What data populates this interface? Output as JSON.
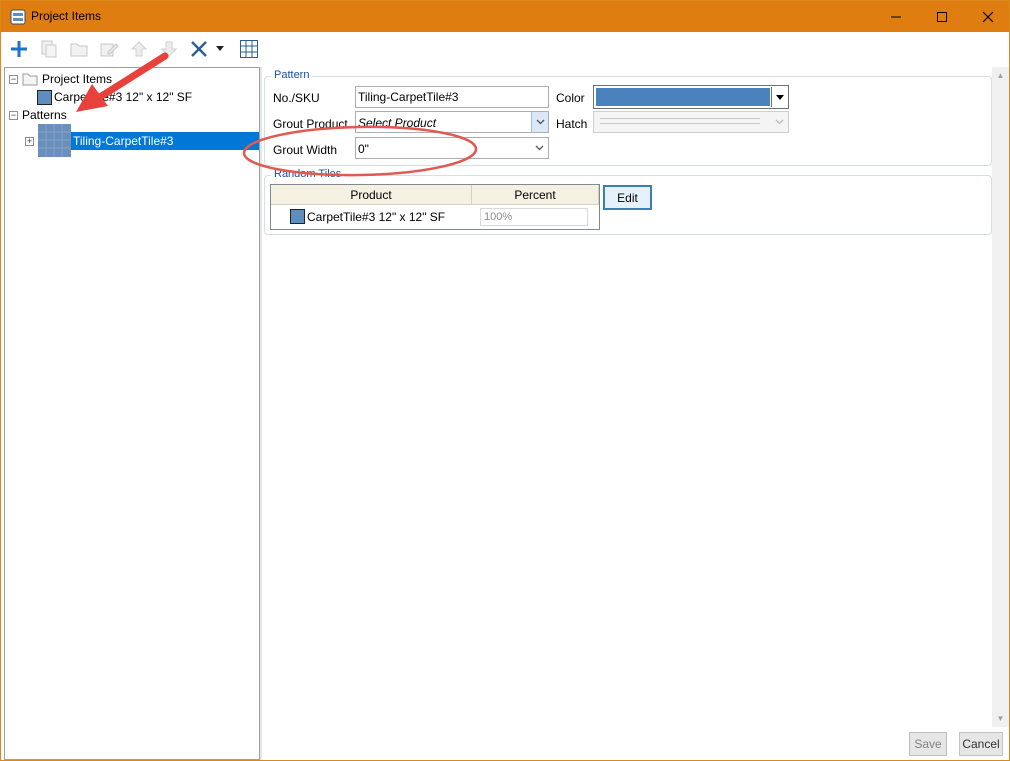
{
  "window": {
    "title": "Project Items",
    "accent_color": "#e07d10",
    "controls": [
      "minimize-icon",
      "maximize-icon",
      "close-icon"
    ]
  },
  "toolbar": {
    "buttons": [
      "add-icon",
      "copy-icon",
      "folder-icon",
      "edit-icon",
      "move-up-icon",
      "move-down-icon",
      "delete-icon",
      "dropdown-icon",
      "grid-icon"
    ]
  },
  "tree": {
    "project_items_label": "Project Items",
    "product_item_label": "CarpetTile#3 12\" x 12\" SF",
    "patterns_label": "Patterns",
    "pattern_item_label": "Tiling-CarpetTile#3",
    "swatch_color": "#5d8ebf"
  },
  "pattern": {
    "group_label": "Pattern",
    "sku_label": "No./SKU",
    "sku_value": "Tiling-CarpetTile#3",
    "color_label": "Color",
    "color_value": "#4a82bd",
    "grout_product_label": "Grout Product",
    "grout_product_placeholder": "Select Product",
    "hatch_label": "Hatch",
    "grout_width_label": "Grout Width",
    "grout_width_value": "0\""
  },
  "random_tiles": {
    "group_label": "Random Tiles",
    "columns": [
      "Product",
      "Percent"
    ],
    "rows": [
      {
        "product": "CarpetTile#3 12\" x 12\" SF",
        "percent": "100%"
      }
    ],
    "edit_label": "Edit"
  },
  "footer": {
    "save_label": "Save",
    "cancel_label": "Cancel"
  }
}
